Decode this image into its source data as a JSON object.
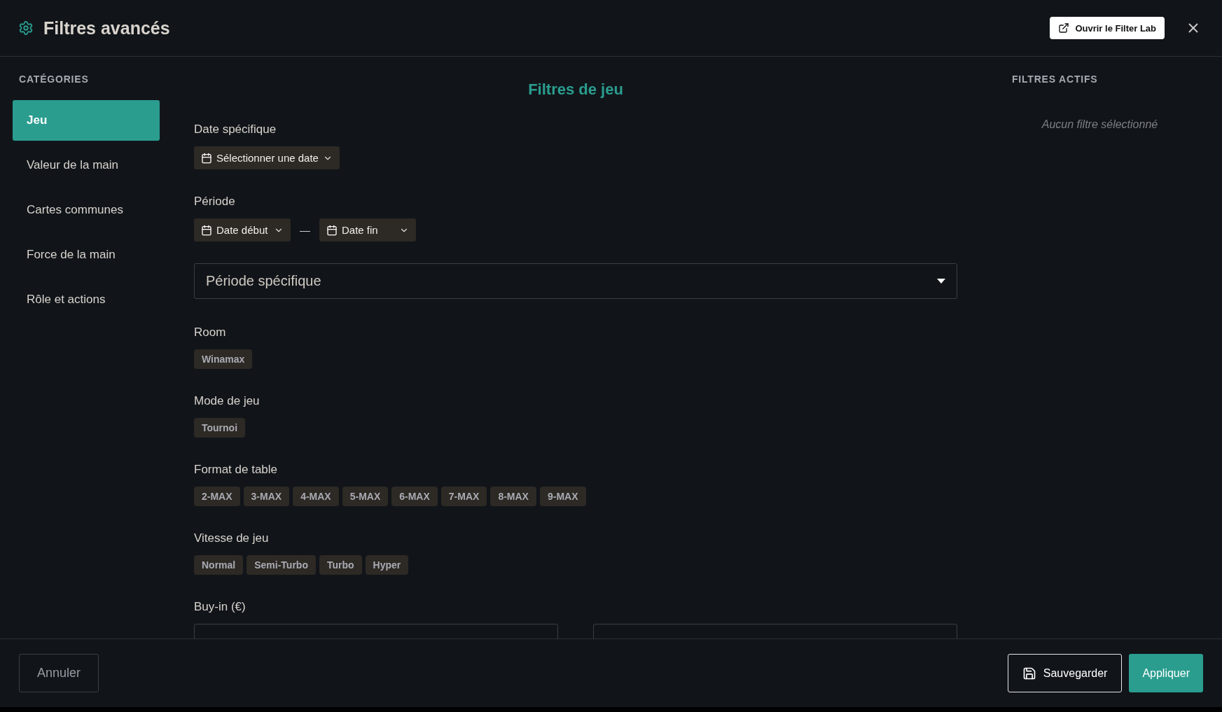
{
  "header": {
    "title": "Filtres avancés",
    "lab_button": "Ouvrir le Filter Lab"
  },
  "sidebar": {
    "heading": "CATÉGORIES",
    "items": [
      {
        "label": "Jeu",
        "selected": true
      },
      {
        "label": "Valeur de la main",
        "selected": false
      },
      {
        "label": "Cartes communes",
        "selected": false
      },
      {
        "label": "Force de la main",
        "selected": false
      },
      {
        "label": "Rôle et actions",
        "selected": false
      }
    ]
  },
  "main": {
    "heading": "Filtres de jeu",
    "sections": [
      {
        "kind": "date",
        "label": "Date spécifique",
        "button": "Sélectionner une date"
      },
      {
        "kind": "range",
        "label": "Période",
        "start": "Date début",
        "separator": "—",
        "end": "Date fin",
        "select": "Période spécifique"
      },
      {
        "kind": "chips",
        "label": "Room",
        "chips": [
          {
            "label": "Winamax",
            "selected": false
          }
        ]
      },
      {
        "kind": "chips",
        "label": "Mode de jeu",
        "chips": [
          {
            "label": "Tournoi",
            "selected": false
          }
        ]
      },
      {
        "kind": "chips",
        "label": "Format de table",
        "chips": [
          {
            "label": "2-MAX",
            "selected": false
          },
          {
            "label": "3-MAX",
            "selected": false
          },
          {
            "label": "4-MAX",
            "selected": false
          },
          {
            "label": "5-MAX",
            "selected": false
          },
          {
            "label": "6-MAX",
            "selected": false
          },
          {
            "label": "7-MAX",
            "selected": false
          },
          {
            "label": "8-MAX",
            "selected": false
          },
          {
            "label": "9-MAX",
            "selected": false
          }
        ]
      },
      {
        "kind": "chips",
        "label": "Vitesse de jeu",
        "chips": [
          {
            "label": "Normal",
            "selected": false
          },
          {
            "label": "Semi-Turbo",
            "selected": false
          },
          {
            "label": "Turbo",
            "selected": false
          },
          {
            "label": "Hyper",
            "selected": false
          }
        ]
      },
      {
        "kind": "numbers",
        "label": "Buy-in (€)"
      }
    ]
  },
  "active_filters": {
    "heading": "FILTRES ACTIFS",
    "empty": "Aucun filtre sélectionné"
  },
  "footer": {
    "cancel": "Annuler",
    "save": "Sauvegarder",
    "apply": "Appliquer"
  }
}
